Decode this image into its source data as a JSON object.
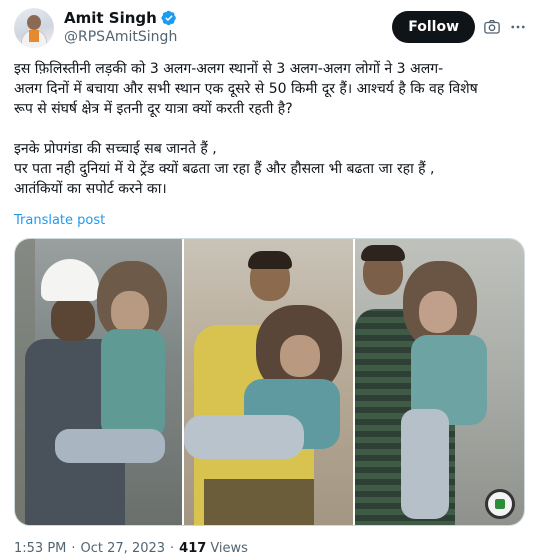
{
  "author": {
    "display_name": "Amit Singh",
    "handle": "@RPSAmitSingh",
    "verified": true
  },
  "actions": {
    "follow_label": "Follow"
  },
  "icons": {
    "verified": "verified-badge-icon",
    "camera": "grok-camera-icon",
    "more": "more-options-icon"
  },
  "tweet": {
    "lines": [
      "इस फ़िलिस्तीनी लड़की को 3 अलग-अलग स्थानों से 3 अलग-अलग लोगों ने 3 अलग-",
      "अलग दिनों में बचाया और सभी स्थान एक दूसरे से 50 किमी दूर हैं। आश्चर्य है कि वह विशेष",
      "रूप से संघर्ष क्षेत्र में इतनी दूर यात्रा क्यों करती रहती है?",
      "इनके प्रोपगंडा की सच्चाई सब जानते हैं ,",
      "पर पता नही दुनियां में ये ट्रेंड क्यों बढता जा रहा हैं और हौसला भी बढता जा रहा हैं ,",
      "आतंकियों का सपोर्ट करने का।"
    ],
    "translate_label": "Translate post"
  },
  "meta": {
    "time": "1:53 PM",
    "date": "Oct 27, 2023",
    "separator": "·",
    "views_count": "417",
    "views_label": "Views"
  },
  "colors": {
    "link": "#1d9bf0",
    "text": "#0f1419",
    "secondary": "#536471",
    "button_bg": "#0f1419"
  }
}
